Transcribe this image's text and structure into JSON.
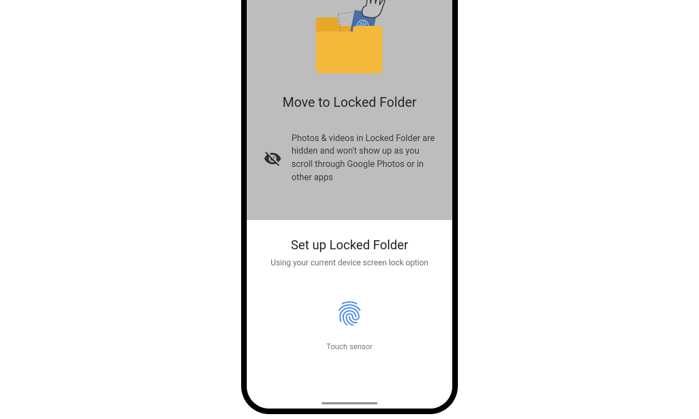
{
  "upper": {
    "title": "Move to Locked Folder",
    "info_text": "Photos & videos in Locked Folder are hidden and won't show up as you scroll through Google Photos or in other apps"
  },
  "sheet": {
    "title": "Set up Locked Folder",
    "subtitle": "Using your current device screen lock option",
    "touch_label": "Touch sensor"
  },
  "colors": {
    "fingerprint": "#4285f4",
    "folder_front": "#f4b83b",
    "folder_back": "#e8a825",
    "photo_card": "#4a6da7"
  }
}
